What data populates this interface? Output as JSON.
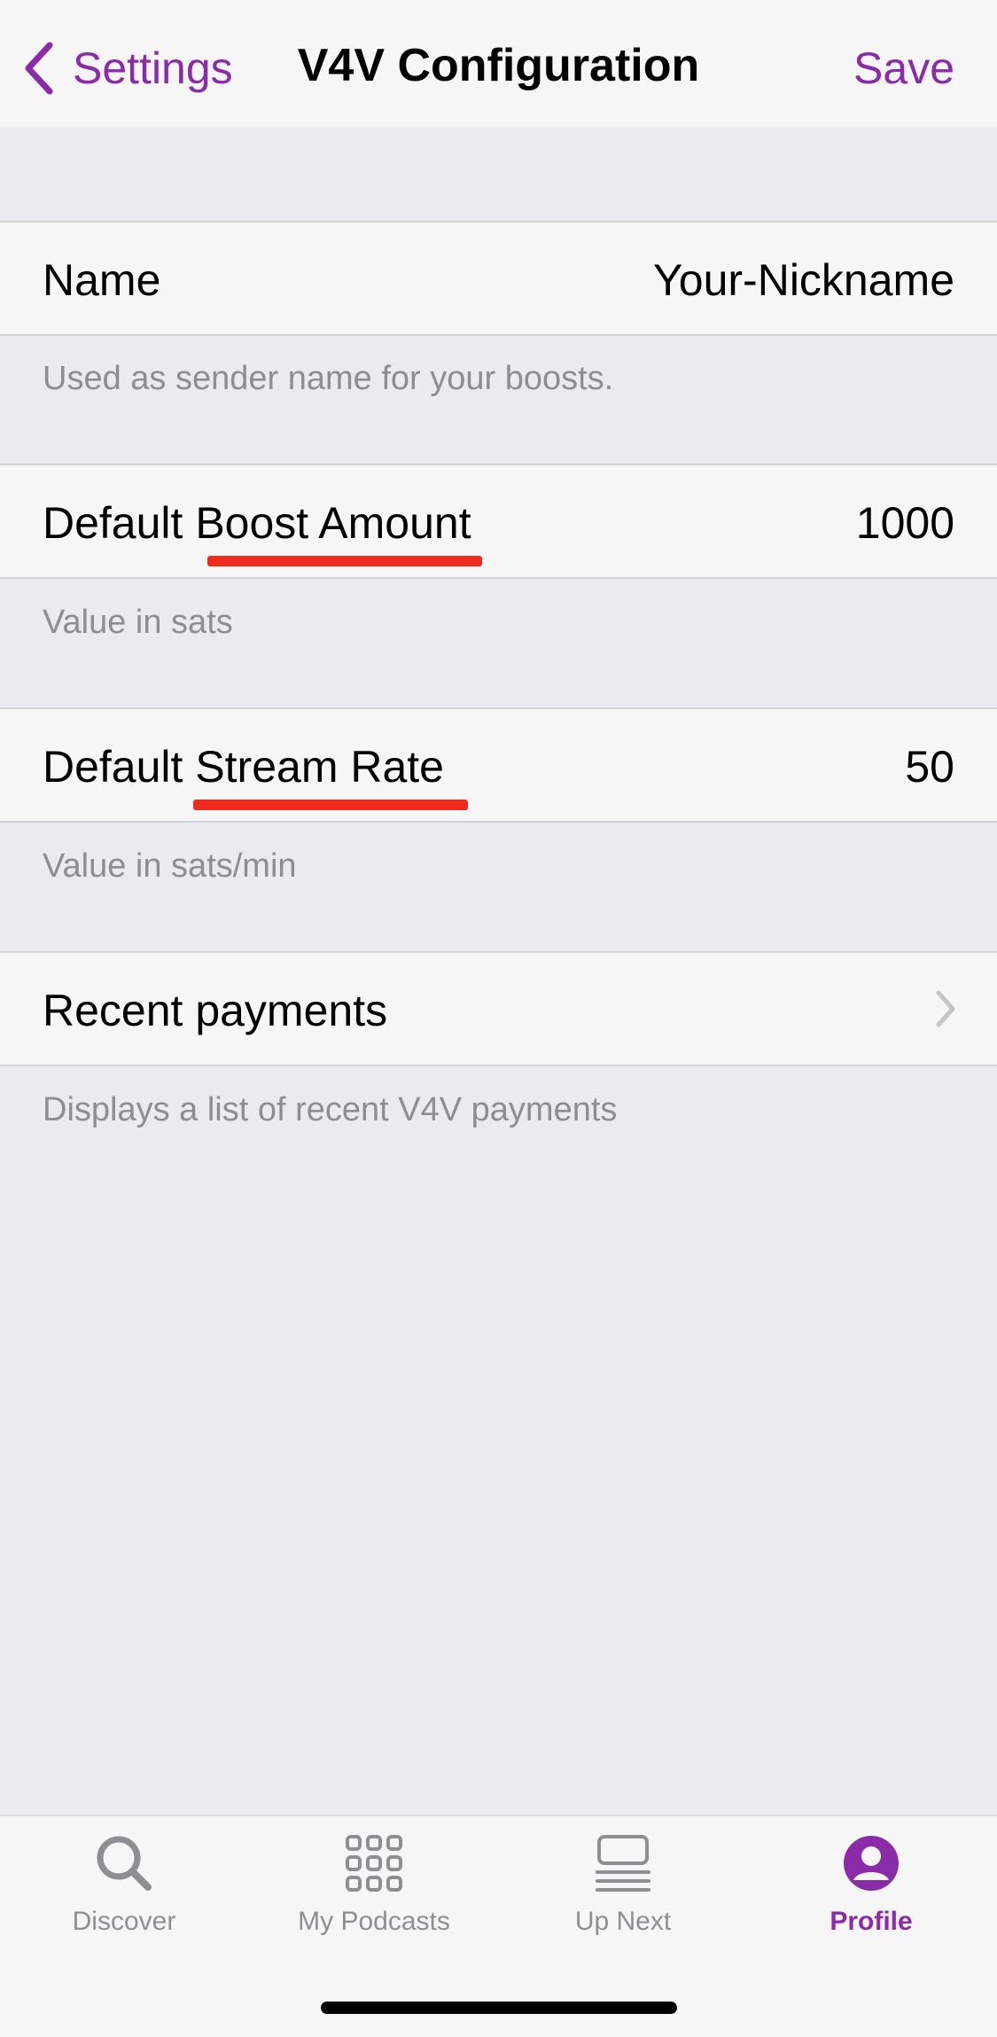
{
  "navbar": {
    "back_label": "Settings",
    "title": "V4V Configuration",
    "save_label": "Save"
  },
  "colors": {
    "accent": "#8A2BA8",
    "annotation_underline": "#EE2B1D",
    "grouped_background": "#EBEAF0",
    "secondary_text": "#8D8D92"
  },
  "settings": {
    "name": {
      "label": "Name",
      "value": "Your-Nickname",
      "footer": "Used as sender name for your boosts."
    },
    "boost": {
      "label": "Default Boost Amount",
      "value": "1000",
      "footer": "Value in sats"
    },
    "stream": {
      "label": "Default Stream Rate",
      "value": "50",
      "footer": "Value in sats/min"
    },
    "recent": {
      "label": "Recent payments",
      "icon": "chevron-right-icon",
      "footer": "Displays a list of recent V4V payments"
    }
  },
  "tabbar": {
    "tabs": [
      {
        "label": "Discover",
        "icon": "search-icon"
      },
      {
        "label": "My Podcasts",
        "icon": "grid-icon"
      },
      {
        "label": "Up Next",
        "icon": "up-next-icon"
      },
      {
        "label": "Profile",
        "icon": "profile-icon",
        "active": true
      }
    ]
  }
}
